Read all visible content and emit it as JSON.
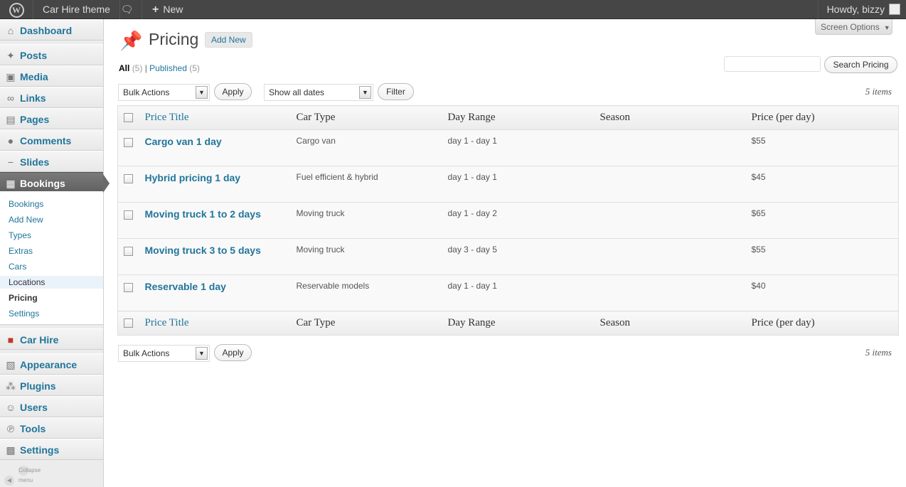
{
  "adminbar": {
    "site_name": "Car Hire theme",
    "new_label": "New",
    "howdy": "Howdy, bizzy"
  },
  "sidebar": {
    "items": [
      {
        "label": "Dashboard",
        "icon": "home-icon"
      },
      {
        "label": "Posts",
        "icon": "pin-icon"
      },
      {
        "label": "Media",
        "icon": "media-icon"
      },
      {
        "label": "Links",
        "icon": "link-icon"
      },
      {
        "label": "Pages",
        "icon": "page-icon"
      },
      {
        "label": "Comments",
        "icon": "comment-icon"
      },
      {
        "label": "Slides",
        "icon": "slides-icon"
      },
      {
        "label": "Bookings",
        "icon": "calendar-icon"
      },
      {
        "label": "Car Hire",
        "icon": "car-hire-icon"
      },
      {
        "label": "Appearance",
        "icon": "appearance-icon"
      },
      {
        "label": "Plugins",
        "icon": "plug-icon"
      },
      {
        "label": "Users",
        "icon": "users-icon"
      },
      {
        "label": "Tools",
        "icon": "tools-icon"
      },
      {
        "label": "Settings",
        "icon": "settings-icon"
      }
    ],
    "submenu": [
      "Bookings",
      "Add New",
      "Types",
      "Extras",
      "Cars",
      "Locations",
      "Pricing",
      "Settings"
    ],
    "collapse": "Collapse menu"
  },
  "header": {
    "screen_options": "Screen Options",
    "title": "Pricing",
    "add_new": "Add New"
  },
  "filters": {
    "all": "All",
    "all_count": "(5)",
    "published": "Published",
    "published_count": "(5)",
    "sep": "|"
  },
  "search": {
    "button": "Search Pricing"
  },
  "actions": {
    "bulk": "Bulk Actions",
    "apply": "Apply",
    "dates": "Show all dates",
    "filter": "Filter",
    "items": "5 items"
  },
  "table": {
    "columns": [
      "Price Title",
      "Car Type",
      "Day Range",
      "Season",
      "Price (per day)"
    ],
    "rows": [
      {
        "title": "Cargo van 1 day",
        "car_type": "Cargo van",
        "range": "day 1 - day 1",
        "season": "",
        "price": "$55"
      },
      {
        "title": "Hybrid pricing 1 day",
        "car_type": "Fuel efficient & hybrid",
        "range": "day 1 - day 1",
        "season": "",
        "price": "$45"
      },
      {
        "title": "Moving truck 1 to 2 days",
        "car_type": "Moving truck",
        "range": "day 1 - day 2",
        "season": "",
        "price": "$65"
      },
      {
        "title": "Moving truck 3 to 5 days",
        "car_type": "Moving truck",
        "range": "day 3 - day 5",
        "season": "",
        "price": "$55"
      },
      {
        "title": "Reservable 1 day",
        "car_type": "Reservable models",
        "range": "day 1 - day 1",
        "season": "",
        "price": "$40"
      }
    ]
  },
  "colors": {
    "link": "#21759b",
    "adminbar": "#464646",
    "current_menu": "#6a6a6a"
  }
}
